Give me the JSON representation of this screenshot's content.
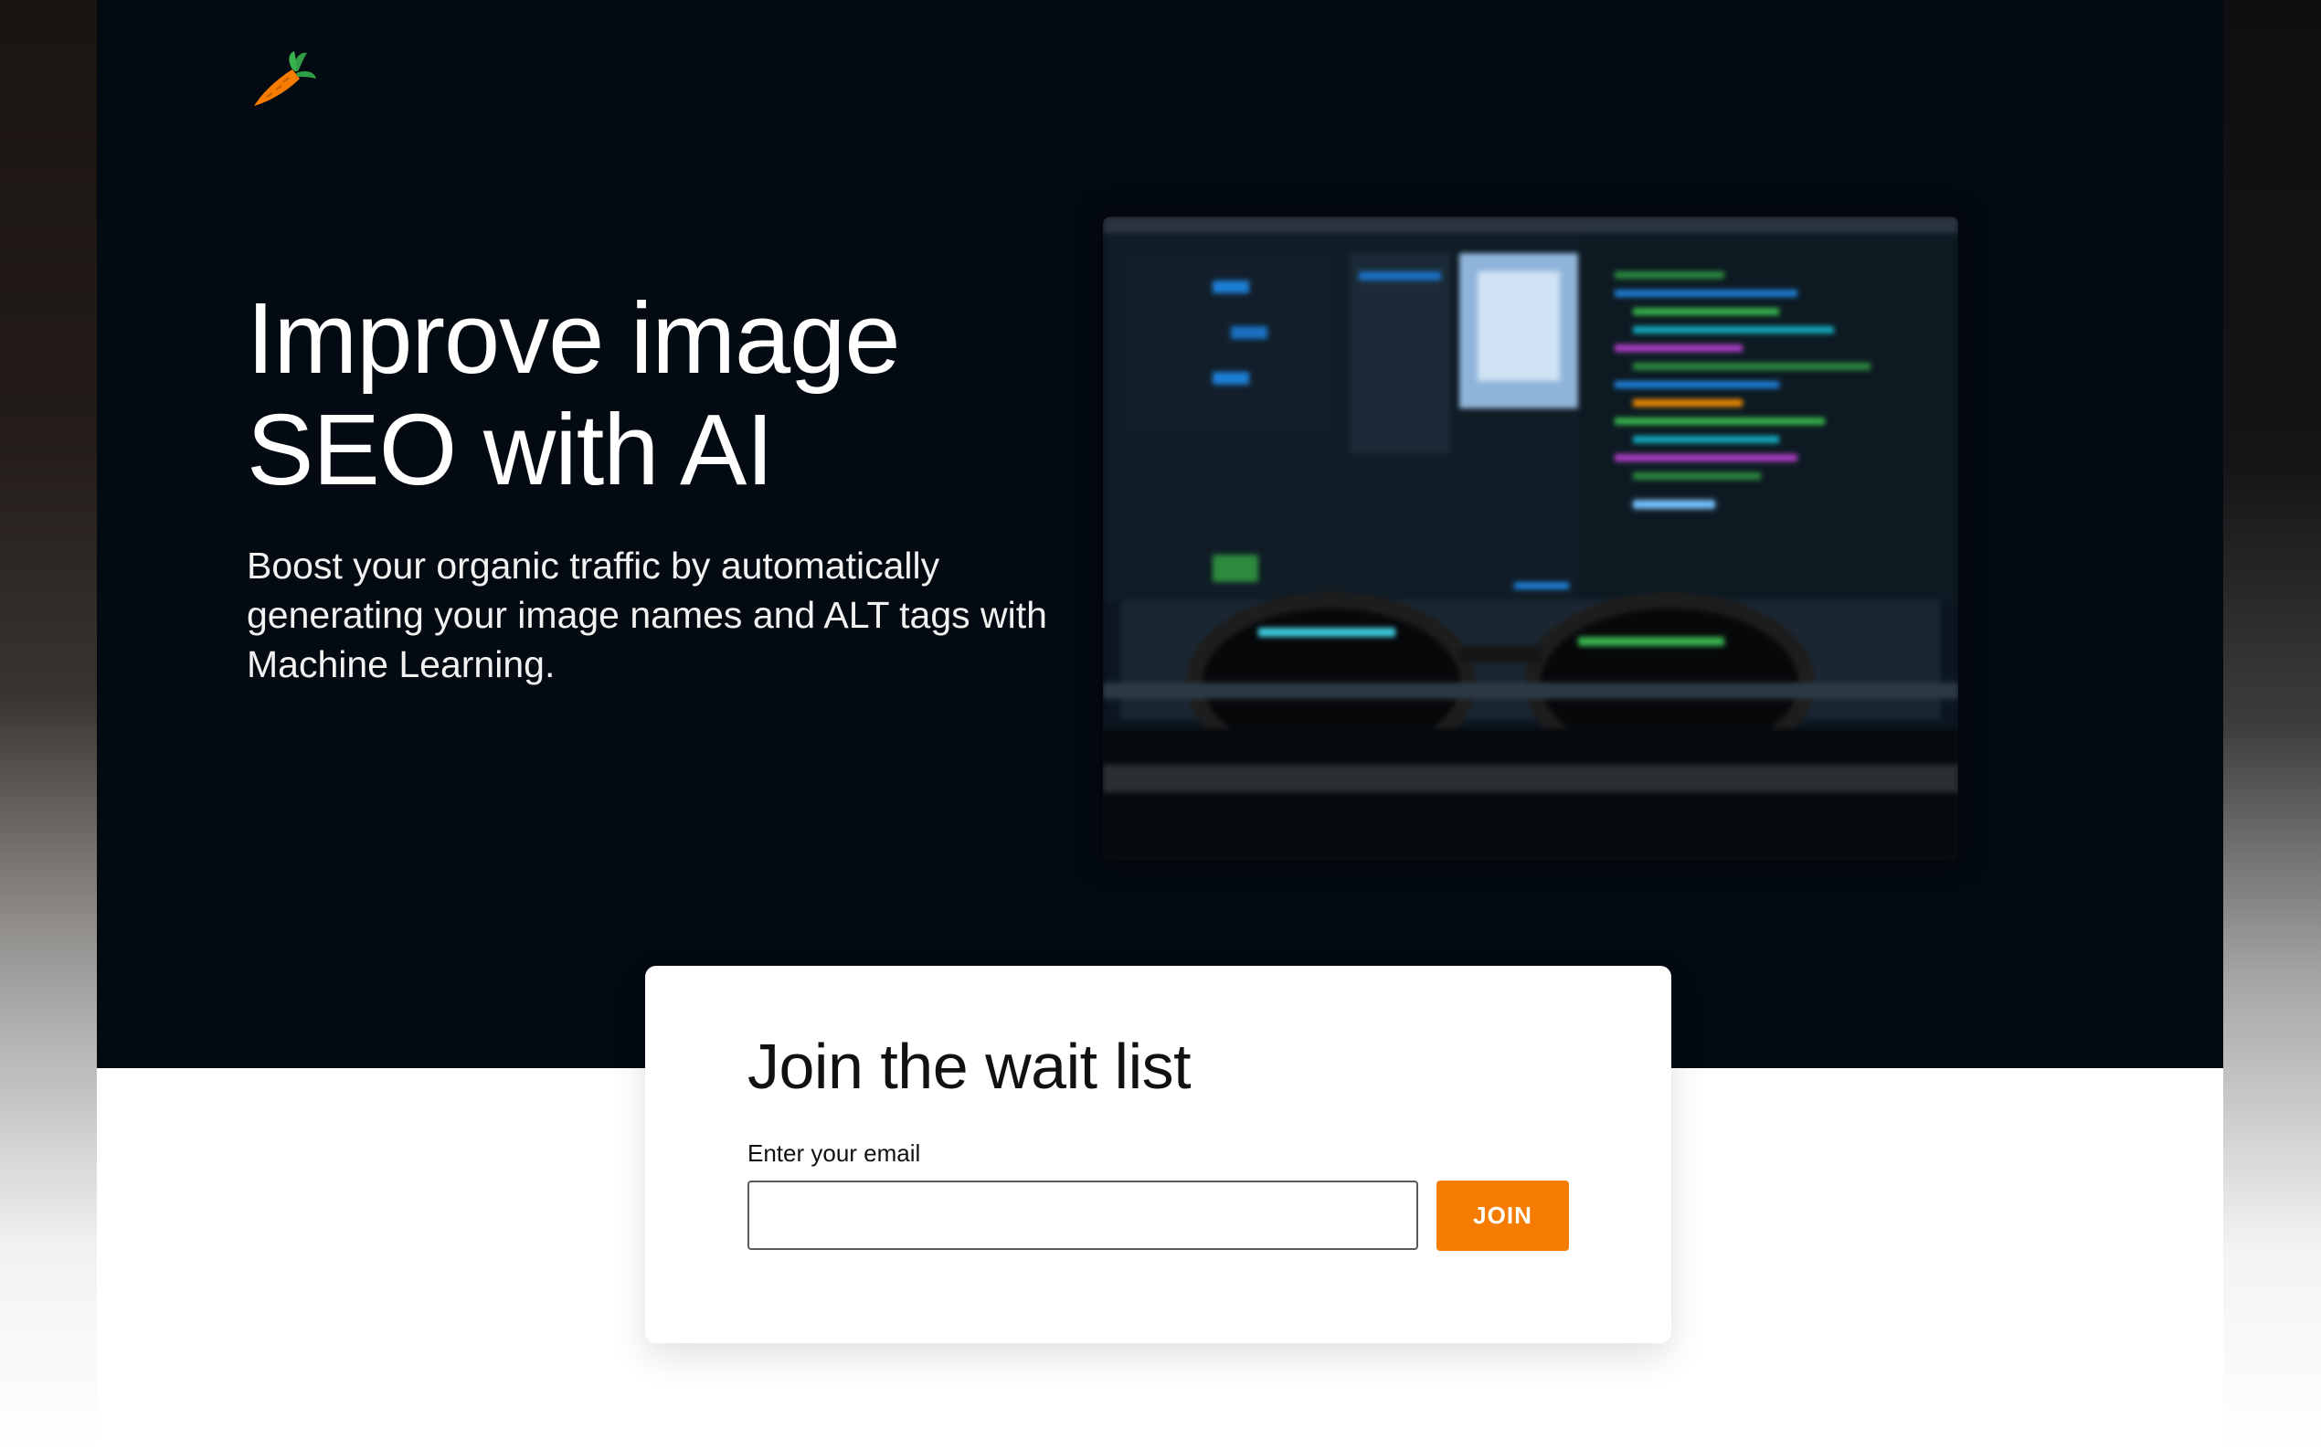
{
  "brand": {
    "logo_icon": "carrot-icon",
    "accent_color": "#f57c00",
    "hero_bg": "#040a12"
  },
  "hero": {
    "headline_line1": "Improve image",
    "headline_line2": "SEO with AI",
    "subtext": "Boost your organic traffic by automatically generating your image names and ALT tags with Machine Learning.",
    "image_icon": "monitor-code-glasses-photo"
  },
  "waitlist": {
    "title": "Join the wait list",
    "email_label": "Enter your email",
    "email_value": "",
    "email_placeholder": "",
    "join_label": "JOIN"
  }
}
